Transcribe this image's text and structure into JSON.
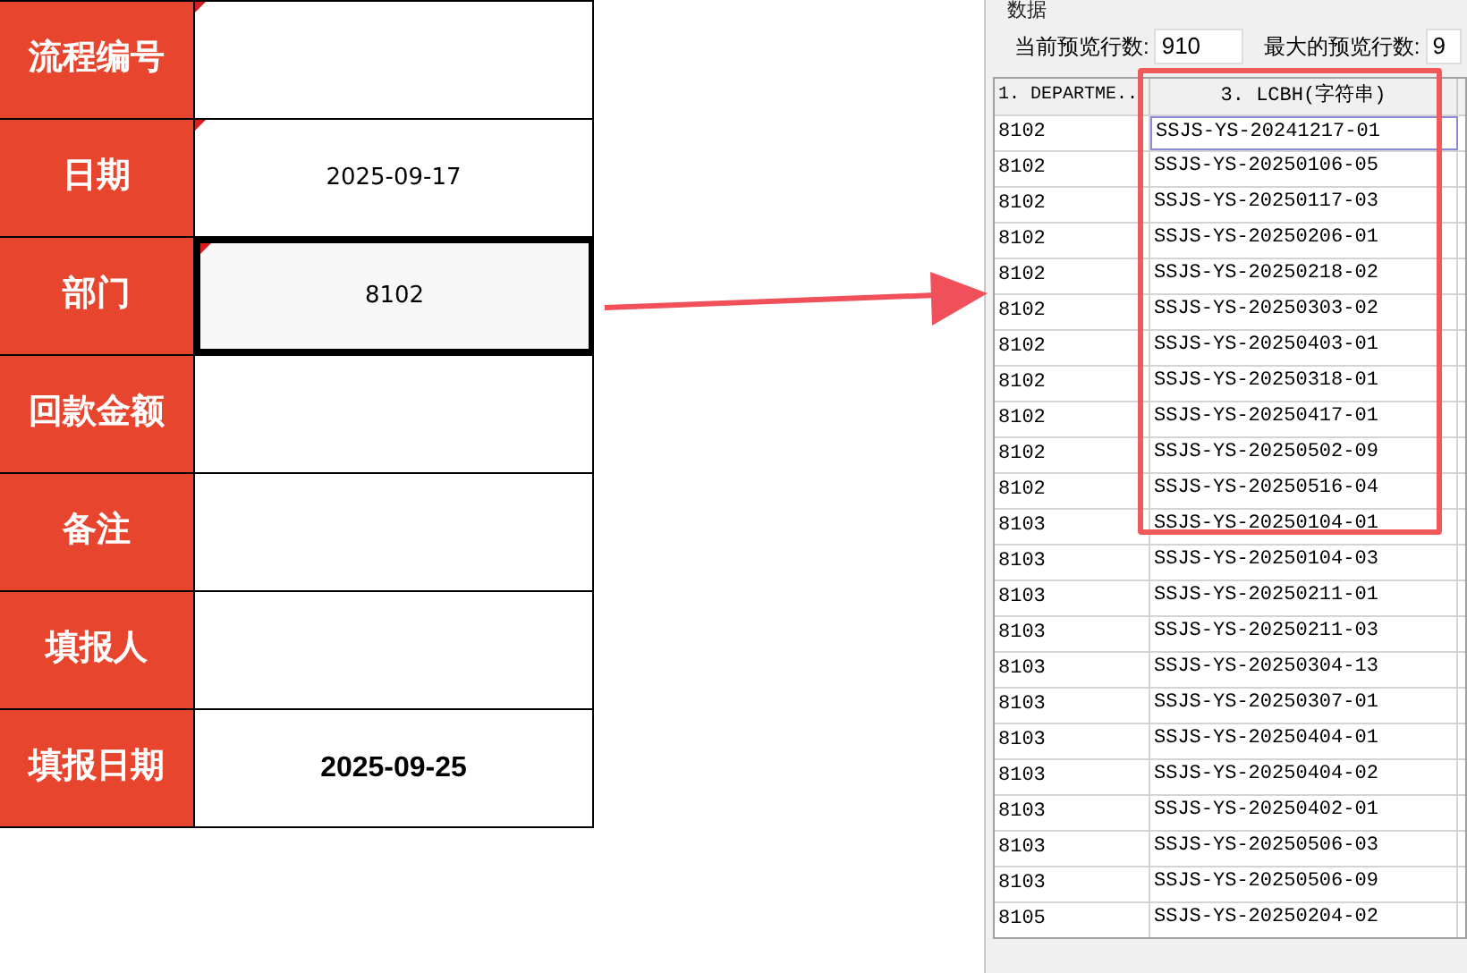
{
  "form": {
    "rows": [
      {
        "label": "流程编号",
        "value": "",
        "selected": false,
        "has_comment": true
      },
      {
        "label": "日期",
        "value": "2025-09-17",
        "selected": false,
        "has_comment": true,
        "bold": false
      },
      {
        "label": "部门",
        "value": "8102",
        "selected": true,
        "has_comment": true,
        "bold": false
      },
      {
        "label": "回款金额",
        "value": "",
        "selected": false,
        "has_comment": false
      },
      {
        "label": "备注",
        "value": "",
        "selected": false,
        "has_comment": false
      },
      {
        "label": "填报人",
        "value": "",
        "selected": false,
        "has_comment": false
      },
      {
        "label": "填报日期",
        "value": "2025-09-25",
        "selected": false,
        "has_comment": false,
        "bold": true
      }
    ]
  },
  "preview": {
    "group_title": "数据",
    "current_rows_label": "当前预览行数:",
    "current_rows": "910",
    "max_rows_label": "最大的预览行数:",
    "max_rows": "9",
    "columns": [
      "1. DEPARTME..",
      "3. LCBH(字符串)"
    ],
    "rows": [
      {
        "department": "8102",
        "lcbh": "SSJS-YS-20241217-01",
        "selected": true
      },
      {
        "department": "8102",
        "lcbh": "SSJS-YS-20250106-05",
        "selected": false
      },
      {
        "department": "8102",
        "lcbh": "SSJS-YS-20250117-03",
        "selected": false
      },
      {
        "department": "8102",
        "lcbh": "SSJS-YS-20250206-01",
        "selected": false
      },
      {
        "department": "8102",
        "lcbh": "SSJS-YS-20250218-02",
        "selected": false
      },
      {
        "department": "8102",
        "lcbh": "SSJS-YS-20250303-02",
        "selected": false
      },
      {
        "department": "8102",
        "lcbh": "SSJS-YS-20250403-01",
        "selected": false
      },
      {
        "department": "8102",
        "lcbh": "SSJS-YS-20250318-01",
        "selected": false
      },
      {
        "department": "8102",
        "lcbh": "SSJS-YS-20250417-01",
        "selected": false
      },
      {
        "department": "8102",
        "lcbh": "SSJS-YS-20250502-09",
        "selected": false
      },
      {
        "department": "8102",
        "lcbh": "SSJS-YS-20250516-04",
        "selected": false
      },
      {
        "department": "8103",
        "lcbh": "SSJS-YS-20250104-01",
        "selected": false
      },
      {
        "department": "8103",
        "lcbh": "SSJS-YS-20250104-03",
        "selected": false
      },
      {
        "department": "8103",
        "lcbh": "SSJS-YS-20250211-01",
        "selected": false
      },
      {
        "department": "8103",
        "lcbh": "SSJS-YS-20250211-03",
        "selected": false
      },
      {
        "department": "8103",
        "lcbh": "SSJS-YS-20250304-13",
        "selected": false
      },
      {
        "department": "8103",
        "lcbh": "SSJS-YS-20250307-01",
        "selected": false
      },
      {
        "department": "8103",
        "lcbh": "SSJS-YS-20250404-01",
        "selected": false
      },
      {
        "department": "8103",
        "lcbh": "SSJS-YS-20250404-02",
        "selected": false
      },
      {
        "department": "8103",
        "lcbh": "SSJS-YS-20250402-01",
        "selected": false
      },
      {
        "department": "8103",
        "lcbh": "SSJS-YS-20250506-03",
        "selected": false
      },
      {
        "department": "8103",
        "lcbh": "SSJS-YS-20250506-09",
        "selected": false
      },
      {
        "department": "8105",
        "lcbh": "SSJS-YS-20250204-02",
        "selected": false
      }
    ]
  }
}
